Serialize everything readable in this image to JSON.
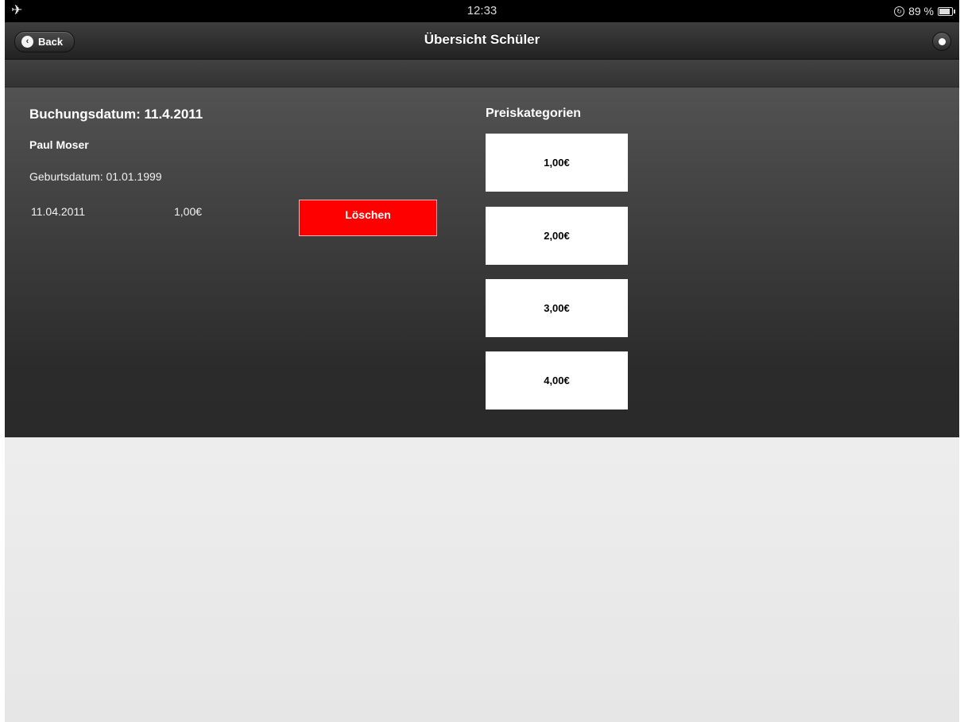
{
  "status_bar": {
    "airplane_icon": "airplane-icon",
    "time": "12:33",
    "battery_percent": "89 %"
  },
  "navbar": {
    "back_label": "Back",
    "title": "Übersicht Schüler",
    "home_icon": "home-icon"
  },
  "booking": {
    "date_label": "Buchungsdatum: 11.4.2011",
    "student_name": "Paul Moser",
    "birth_date": "Geburtsdatum: 01.01.1999",
    "entries": [
      {
        "date": "11.04.2011",
        "amount": "1,00€"
      }
    ],
    "delete_label": "Löschen"
  },
  "price_categories": {
    "title": "Preiskategorien",
    "options": [
      "1,00€",
      "2,00€",
      "3,00€",
      "4,00€"
    ]
  },
  "colors": {
    "delete_button": "#ff0000",
    "navbar": "#2b2b2b",
    "content_bg": "#3a3a3a"
  }
}
